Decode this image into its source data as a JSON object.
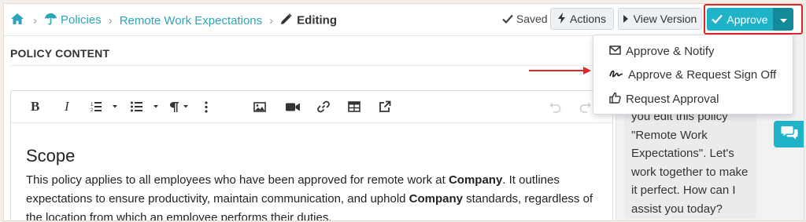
{
  "breadcrumb": {
    "items": [
      {
        "label": "Policies",
        "icon": "umbrella-icon"
      },
      {
        "label": "Remote Work Expectations"
      }
    ],
    "current": "Editing",
    "current_icon": "pencil-icon",
    "separator": "›"
  },
  "toolbar": {
    "saved_label": "Saved",
    "actions_label": "Actions",
    "view_version_label": "View Version",
    "approve_label": "Approve"
  },
  "colors": {
    "accent": "#1fb3c7",
    "accent_dark": "#128a9a",
    "link": "#2aa6b8",
    "highlight_outline": "#e02626"
  },
  "section": {
    "title": "POLICY CONTENT"
  },
  "editor": {
    "heading": "Scope",
    "paragraph": {
      "part1": "This policy applies to all employees who have been approved for remote work at ",
      "company1": "Company",
      "part2": ". It outlines expectations to ensure productivity, maintain communication, and uphold ",
      "company2": "Company",
      "part3": " standards, regardless of the location from which an employee performs their duties."
    },
    "tools": [
      "bold",
      "italic",
      "numbered-list",
      "bulleted-list",
      "paragraph-format",
      "more",
      "insert-image",
      "insert-video",
      "insert-link",
      "insert-table",
      "embed",
      "undo",
      "redo"
    ]
  },
  "dropdown": {
    "items": [
      {
        "label": "Approve & Notify",
        "icon": "envelope-icon"
      },
      {
        "label": "Approve & Request Sign Off",
        "icon": "signature-icon"
      },
      {
        "label": "Request Approval",
        "icon": "thumbs-up-icon"
      }
    ]
  },
  "chat": {
    "message": "you edit this policy \"Remote Work Expectations\". Let's work together to make it perfect. How can I assist you today?"
  }
}
